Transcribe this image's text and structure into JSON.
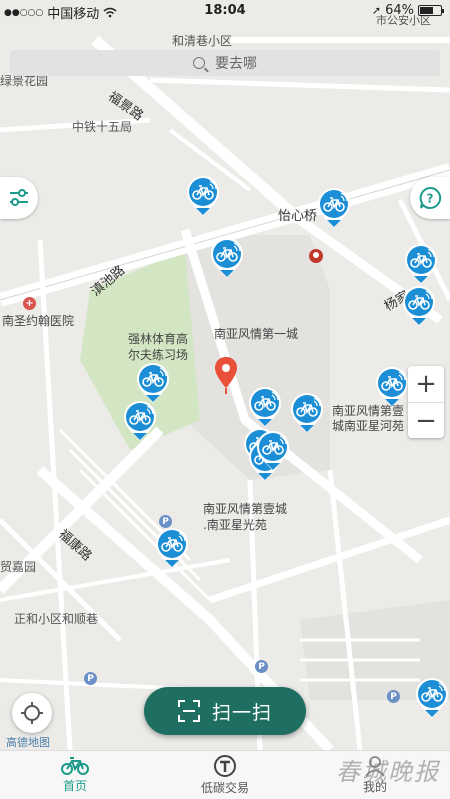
{
  "status_bar": {
    "carrier": "中国移动",
    "time": "18:04",
    "battery": "64%",
    "battery_level": 0.64
  },
  "map": {
    "labels": [
      {
        "text": "和清巷小区",
        "kind": "place"
      },
      {
        "text": "绿景花园",
        "kind": "place"
      },
      {
        "text": "福景路",
        "kind": "road"
      },
      {
        "text": "中铁十五局",
        "kind": "place"
      },
      {
        "text": "怡心桥",
        "kind": "road"
      },
      {
        "text": "滇池路",
        "kind": "road"
      },
      {
        "text": "杨家",
        "kind": "road"
      },
      {
        "text": "南圣约翰医院",
        "kind": "place"
      },
      {
        "text": "南亚风情第一城",
        "kind": "place"
      },
      {
        "text": "强林体育高",
        "kind": "place"
      },
      {
        "text": "尔夫练习场",
        "kind": "place"
      },
      {
        "text": "南亚风情第壹",
        "kind": "place"
      },
      {
        "text": "城南亚星河苑",
        "kind": "place"
      },
      {
        "text": "南亚风情第壹城",
        "kind": "place"
      },
      {
        "text": ".南亚星光苑",
        "kind": "place"
      },
      {
        "text": "福康路",
        "kind": "road"
      },
      {
        "text": "贸嘉园",
        "kind": "place"
      },
      {
        "text": "正和小区和顺巷",
        "kind": "place"
      },
      {
        "text": "市公安小区",
        "kind": "place"
      }
    ],
    "brand": "高德地图"
  },
  "search": {
    "placeholder": "要去哪"
  },
  "controls": {
    "zoom_in": "+",
    "zoom_out": "−",
    "help": "?",
    "scan_label": "扫一扫"
  },
  "tabs": [
    {
      "label": "首页",
      "icon": "bike-icon",
      "active": true
    },
    {
      "label": "低碳交易",
      "icon": "trade-icon",
      "active": false
    },
    {
      "label": "我的",
      "icon": "user-icon",
      "active": false
    }
  ],
  "watermark": "春城晚报",
  "colors": {
    "accent": "#1d9b8a",
    "scan_button": "#1f6e62",
    "bike_marker": "#1b8ed6",
    "destination_pin": "#e8503a"
  }
}
